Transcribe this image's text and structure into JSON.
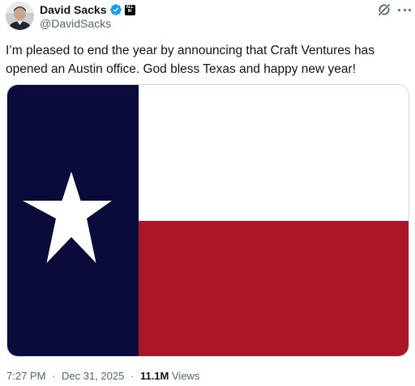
{
  "author": {
    "display_name": "David Sacks",
    "handle": "@DavidSacks",
    "verified_icon": "verified-badge-icon",
    "affiliation_badge_lines": [
      "ALL",
      "IN"
    ],
    "avatar_icon": "avatar"
  },
  "header_actions": {
    "grok_icon": "grok-icon",
    "more_icon": "more-icon"
  },
  "tweet": {
    "text_lines": [
      "I’m pleased to end the year by announcing that Craft Ventures has",
      "opened an Austin office. God bless Texas and happy new year!"
    ],
    "media": {
      "type": "image",
      "subject_icon": "texas-flag",
      "colors": {
        "canton": "#0a0b3a",
        "white": "#ffffff",
        "red": "#ab1727",
        "star": "#ffffff"
      }
    },
    "meta": {
      "time": "7:27 PM",
      "date": "Dec 31, 2025",
      "separator": "·",
      "views_count": "11.1M",
      "views_label": "Views"
    }
  },
  "colors": {
    "text_primary": "#0f1419",
    "text_secondary": "#536471",
    "verified_blue": "#1d9bf0",
    "border": "#cfd9de"
  }
}
